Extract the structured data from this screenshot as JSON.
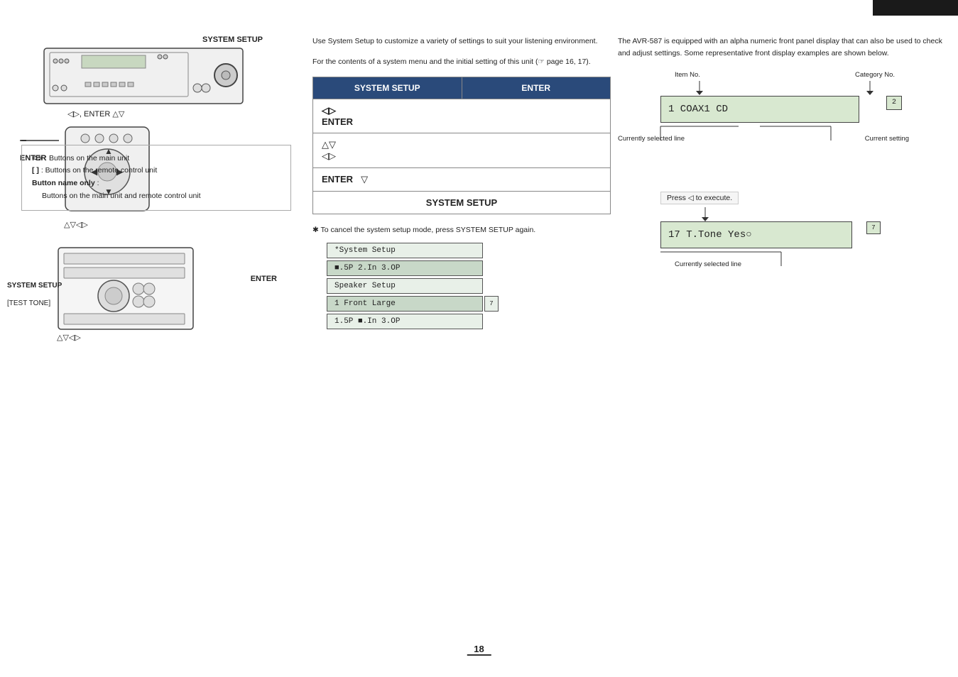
{
  "page": {
    "number": "18",
    "top_bar_color": "#1a1a1a"
  },
  "header": {
    "section_title": "SYSTEM SETUP"
  },
  "intro": {
    "paragraph1": "Use System Setup to customize a variety of settings to suit your listening environment.",
    "paragraph2": "For the contents of a system menu and the initial setting of this unit (☞ page 16, 17)."
  },
  "right_intro": {
    "text": "The AVR-587 is equipped with an alpha numeric front panel display that can also be used to check and adjust settings. Some representative front display examples are shown below."
  },
  "main_unit_label": "SYSTEM SETUP",
  "main_unit_arrows": "◁▷, ENTER  △▽",
  "remote_enter": "ENTER",
  "remote_arrows": "△▽◁▷",
  "receiver_system_setup": "SYSTEM SETUP",
  "receiver_enter": "ENTER",
  "receiver_test_tone": "[TEST TONE]",
  "receiver_arrows": "△▽◁▷",
  "operation_table": {
    "header": [
      "SYSTEM SETUP",
      "ENTER"
    ],
    "rows": [
      {
        "col1": "◁▷\nENTER",
        "col2": ""
      },
      {
        "col1": "△▽\n◁▷",
        "col2": ""
      },
      {
        "col1": "ENTER    ▽",
        "col2": ""
      },
      {
        "col1": "SYSTEM SETUP",
        "col2": ""
      }
    ]
  },
  "cancel_note": "✱ To cancel the system setup mode, press SYSTEM SETUP again.",
  "lcd_screens": [
    {
      "text": "*System Setup",
      "highlighted": false
    },
    {
      "text": "■.5P 2.In 3.OP",
      "highlighted": true
    },
    {
      "text": "Speaker Setup",
      "highlighted": false
    },
    {
      "text": "1 Front   Large",
      "highlighted": true,
      "corner": "7"
    },
    {
      "text": "1.5P ■.In 3.OP",
      "highlighted": false
    }
  ],
  "display_diagram1": {
    "item_no_label": "Item No.",
    "category_no_label": "Category No.",
    "display_text": "1  COAX1   CD",
    "category_number": "2",
    "currently_selected_line": "Currently selected line",
    "current_setting": "Current setting"
  },
  "display_diagram2": {
    "press_note": "Press ◁ to execute.",
    "display_text": "17 T.Tone  Yes○",
    "corner": "7",
    "currently_selected_line": "Currently selected line"
  },
  "legend": {
    "row1_symbols": "< >",
    "row1_text": ": Buttons on the main unit",
    "row2_symbols": "[  ]",
    "row2_text": ": Buttons on the remote control unit",
    "row3_label": "Button name only",
    "row3_text": ":",
    "row3_detail": "Buttons on the main unit and remote control unit"
  }
}
